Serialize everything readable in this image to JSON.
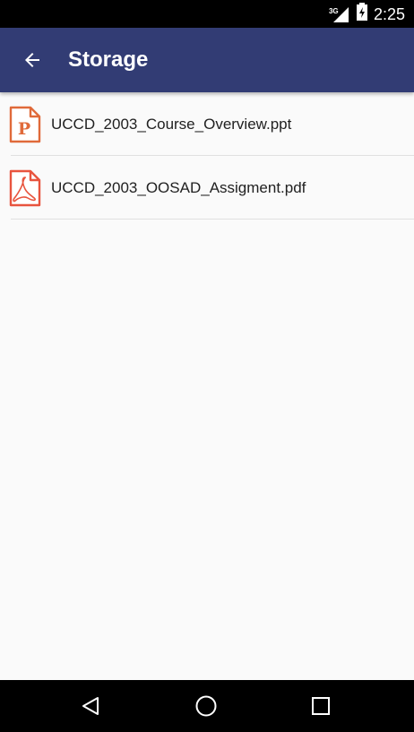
{
  "status_bar": {
    "network": "3G",
    "time": "2:25"
  },
  "app_bar": {
    "title": "Storage"
  },
  "files": [
    {
      "name": "UCCD_2003_Course_Overview.ppt",
      "type": "ppt-icon",
      "color": "#e06a3a"
    },
    {
      "name": "UCCD_2003_OOSAD_Assigment.pdf",
      "type": "pdf-icon",
      "color": "#e8543e"
    }
  ],
  "colors": {
    "app_bar": "#323c74",
    "background": "#fafafa"
  }
}
